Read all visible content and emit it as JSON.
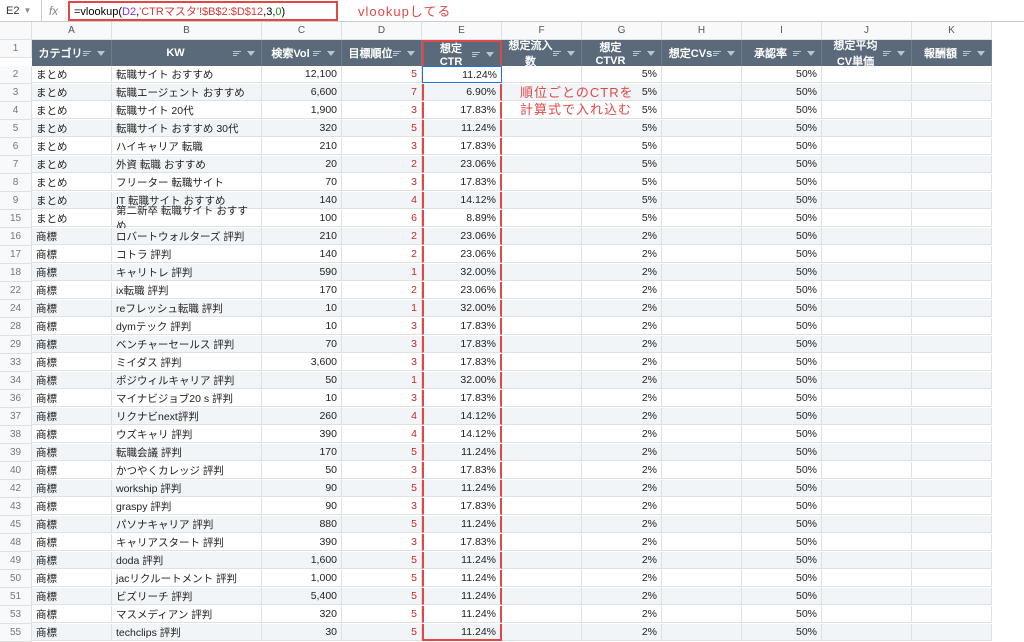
{
  "cellRef": "E2",
  "formula": {
    "p1": "=vlookup(",
    "p2": "D2",
    "p3": ",",
    "p4": "'CTRマスタ'!$B$2:$D$12",
    "p5": ",3,",
    "p6": "0",
    "p7": ")"
  },
  "annoFx": "vlookupしてる",
  "annoBody1": "順位ごとのCTRを",
  "annoBody2": "計算式で入れ込む",
  "cols": [
    "A",
    "B",
    "C",
    "D",
    "E",
    "F",
    "G",
    "H",
    "I",
    "J",
    "K"
  ],
  "headers": [
    "カテゴリ",
    "KW",
    "検索Vol",
    "目標順位",
    "想定CTR",
    "想定流入数",
    "想定CTVR",
    "想定CVs",
    "承認率",
    "想定平均CV単価",
    "報酬額"
  ],
  "ctvr": {
    "matome": "5%",
    "brand": "2%"
  },
  "approval": "50%",
  "rows": [
    {
      "n": 2,
      "cat": "まとめ",
      "kw": "転職サイト おすすめ",
      "vol": "12,100",
      "rank": "5",
      "ctr": "11.24%",
      "t": "m"
    },
    {
      "n": 3,
      "cat": "まとめ",
      "kw": "転職エージェント おすすめ",
      "vol": "6,600",
      "rank": "7",
      "ctr": "6.90%",
      "t": "m"
    },
    {
      "n": 4,
      "cat": "まとめ",
      "kw": "転職サイト 20代",
      "vol": "1,900",
      "rank": "3",
      "ctr": "17.83%",
      "t": "m"
    },
    {
      "n": 5,
      "cat": "まとめ",
      "kw": "転職サイト おすすめ 30代",
      "vol": "320",
      "rank": "5",
      "ctr": "11.24%",
      "t": "m"
    },
    {
      "n": 6,
      "cat": "まとめ",
      "kw": "ハイキャリア 転職",
      "vol": "210",
      "rank": "3",
      "ctr": "17.83%",
      "t": "m"
    },
    {
      "n": 7,
      "cat": "まとめ",
      "kw": "外資 転職 おすすめ",
      "vol": "20",
      "rank": "2",
      "ctr": "23.06%",
      "t": "m"
    },
    {
      "n": 8,
      "cat": "まとめ",
      "kw": "フリーター 転職サイト",
      "vol": "70",
      "rank": "3",
      "ctr": "17.83%",
      "t": "m"
    },
    {
      "n": 9,
      "cat": "まとめ",
      "kw": "IT 転職サイト おすすめ",
      "vol": "140",
      "rank": "4",
      "ctr": "14.12%",
      "t": "m"
    },
    {
      "n": 15,
      "cat": "まとめ",
      "kw": "第二新卒 転職サイト おすすめ",
      "vol": "100",
      "rank": "6",
      "ctr": "8.89%",
      "t": "m"
    },
    {
      "n": 16,
      "cat": "商標",
      "kw": "ロバートウォルターズ 評判",
      "vol": "210",
      "rank": "2",
      "ctr": "23.06%",
      "t": "b"
    },
    {
      "n": 17,
      "cat": "商標",
      "kw": "コトラ 評判",
      "vol": "140",
      "rank": "2",
      "ctr": "23.06%",
      "t": "b"
    },
    {
      "n": 18,
      "cat": "商標",
      "kw": "キャリトレ 評判",
      "vol": "590",
      "rank": "1",
      "ctr": "32.00%",
      "t": "b"
    },
    {
      "n": 22,
      "cat": "商標",
      "kw": "ix転職 評判",
      "vol": "170",
      "rank": "2",
      "ctr": "23.06%",
      "t": "b"
    },
    {
      "n": 24,
      "cat": "商標",
      "kw": "reフレッシュ転職 評判",
      "vol": "10",
      "rank": "1",
      "ctr": "32.00%",
      "t": "b"
    },
    {
      "n": 28,
      "cat": "商標",
      "kw": "dymテック 評判",
      "vol": "10",
      "rank": "3",
      "ctr": "17.83%",
      "t": "b"
    },
    {
      "n": 29,
      "cat": "商標",
      "kw": "ベンチャーセールス 評判",
      "vol": "70",
      "rank": "3",
      "ctr": "17.83%",
      "t": "b"
    },
    {
      "n": 33,
      "cat": "商標",
      "kw": "ミイダス 評判",
      "vol": "3,600",
      "rank": "3",
      "ctr": "17.83%",
      "t": "b"
    },
    {
      "n": 34,
      "cat": "商標",
      "kw": "ポジウィルキャリア 評判",
      "vol": "50",
      "rank": "1",
      "ctr": "32.00%",
      "t": "b"
    },
    {
      "n": 36,
      "cat": "商標",
      "kw": "マイナビジョブ20 s 評判",
      "vol": "10",
      "rank": "3",
      "ctr": "17.83%",
      "t": "b"
    },
    {
      "n": 37,
      "cat": "商標",
      "kw": "リクナビnext評判",
      "vol": "260",
      "rank": "4",
      "ctr": "14.12%",
      "t": "b"
    },
    {
      "n": 38,
      "cat": "商標",
      "kw": "ウズキャリ 評判",
      "vol": "390",
      "rank": "4",
      "ctr": "14.12%",
      "t": "b"
    },
    {
      "n": 39,
      "cat": "商標",
      "kw": "転職会議 評判",
      "vol": "170",
      "rank": "5",
      "ctr": "11.24%",
      "t": "b"
    },
    {
      "n": 40,
      "cat": "商標",
      "kw": "かつやくカレッジ 評判",
      "vol": "50",
      "rank": "3",
      "ctr": "17.83%",
      "t": "b"
    },
    {
      "n": 42,
      "cat": "商標",
      "kw": "workship 評判",
      "vol": "90",
      "rank": "5",
      "ctr": "11.24%",
      "t": "b"
    },
    {
      "n": 43,
      "cat": "商標",
      "kw": "graspy 評判",
      "vol": "90",
      "rank": "3",
      "ctr": "17.83%",
      "t": "b"
    },
    {
      "n": 45,
      "cat": "商標",
      "kw": "パソナキャリア 評判",
      "vol": "880",
      "rank": "5",
      "ctr": "11.24%",
      "t": "b"
    },
    {
      "n": 48,
      "cat": "商標",
      "kw": "キャリアスタート 評判",
      "vol": "390",
      "rank": "3",
      "ctr": "17.83%",
      "t": "b"
    },
    {
      "n": 49,
      "cat": "商標",
      "kw": "doda 評判",
      "vol": "1,600",
      "rank": "5",
      "ctr": "11.24%",
      "t": "b"
    },
    {
      "n": 50,
      "cat": "商標",
      "kw": "jacリクルートメント 評判",
      "vol": "1,000",
      "rank": "5",
      "ctr": "11.24%",
      "t": "b"
    },
    {
      "n": 51,
      "cat": "商標",
      "kw": "ビズリーチ 評判",
      "vol": "5,400",
      "rank": "5",
      "ctr": "11.24%",
      "t": "b"
    },
    {
      "n": 53,
      "cat": "商標",
      "kw": "マスメディアン 評判",
      "vol": "320",
      "rank": "5",
      "ctr": "11.24%",
      "t": "b"
    },
    {
      "n": 55,
      "cat": "商標",
      "kw": "techclips 評判",
      "vol": "30",
      "rank": "5",
      "ctr": "11.24%",
      "t": "b"
    }
  ]
}
